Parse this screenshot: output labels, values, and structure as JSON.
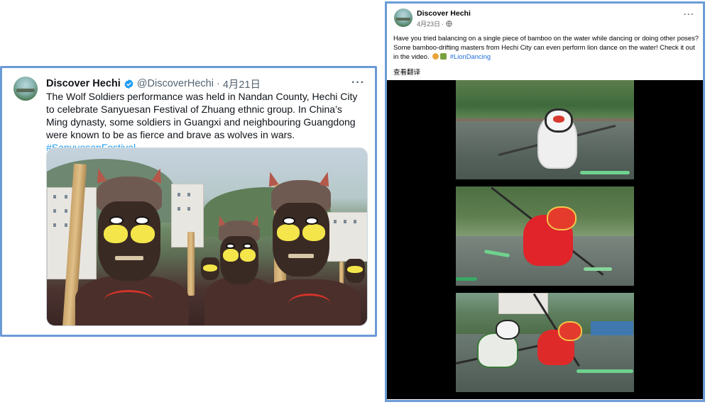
{
  "twitter": {
    "name": "Discover Hechi",
    "handle": "@DiscoverHechi",
    "separator": "·",
    "date": "4月21日",
    "more": "···",
    "text": "The Wolf Soldiers performance was held in Nandan County, Hechi City to celebrate Sanyuesan Festival of Zhuang ethnic group. In China’s Ming dynasty, some soldiers in Guangxi and neighbouring Guangdong were known to be as fierce and brave as wolves in wars.",
    "hashtag": "#SanyuesanFestival",
    "verified_color": "#1d9bf0",
    "accent": "#1d9bf0"
  },
  "facebook": {
    "name": "Discover Hechi",
    "date": "4月23日",
    "separator": "·",
    "more": "···",
    "text": "Have you tried balancing on a single piece of bamboo on the water while dancing or doing other poses? Some bamboo-drifting masters from Hechi City can even perform lion dance on the water! Check it out in the video.",
    "hashtag": "#LionDancing",
    "translate": "查看翻译",
    "accent": "#216fdb"
  },
  "icons": {
    "verified": "verified-badge-icon",
    "globe": "globe-icon",
    "more": "more-options-icon"
  }
}
